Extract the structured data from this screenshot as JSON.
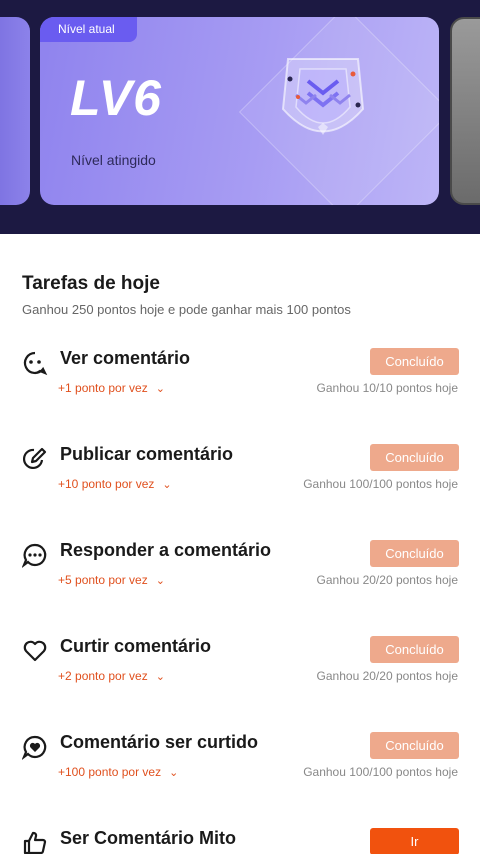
{
  "level_card": {
    "badge": "Nível atual",
    "level": "LV6",
    "status": "Nível atingido",
    "emblem_icon": "level-emblem-icon"
  },
  "tasks_section": {
    "title": "Tarefas de hoje",
    "subtitle": "Ganhou 250 pontos hoje e pode ganhar mais 100 pontos"
  },
  "tasks": [
    {
      "icon": "chat-eye-icon",
      "name": "Ver comentário",
      "points": "+1 ponto por vez",
      "progress": "Ganhou 10/10 pontos hoje",
      "button": "Concluído"
    },
    {
      "icon": "edit-circle-icon",
      "name": "Publicar comentário",
      "points": "+10 ponto por vez",
      "progress": "Ganhou 100/100 pontos hoje",
      "button": "Concluído"
    },
    {
      "icon": "chat-dots-icon",
      "name": "Responder a comentário",
      "points": "+5 ponto por vez",
      "progress": "Ganhou 20/20 pontos hoje",
      "button": "Concluído"
    },
    {
      "icon": "heart-outline-icon",
      "name": "Curtir comentário",
      "points": "+2 ponto por vez",
      "progress": "Ganhou 20/20 pontos hoje",
      "button": "Concluído"
    },
    {
      "icon": "heart-chat-icon",
      "name": "Comentário ser curtido",
      "points": "+100 ponto por vez",
      "progress": "Ganhou 100/100 pontos hoje",
      "button": "Concluído"
    },
    {
      "icon": "thumbs-up-icon",
      "name": "Ser Comentário Mito",
      "button": "Ir"
    }
  ],
  "colors": {
    "accent": "#f1520e",
    "done_button": "#eea98c",
    "card_purple": "#8f83ee",
    "banner_bg": "#1c1942"
  }
}
